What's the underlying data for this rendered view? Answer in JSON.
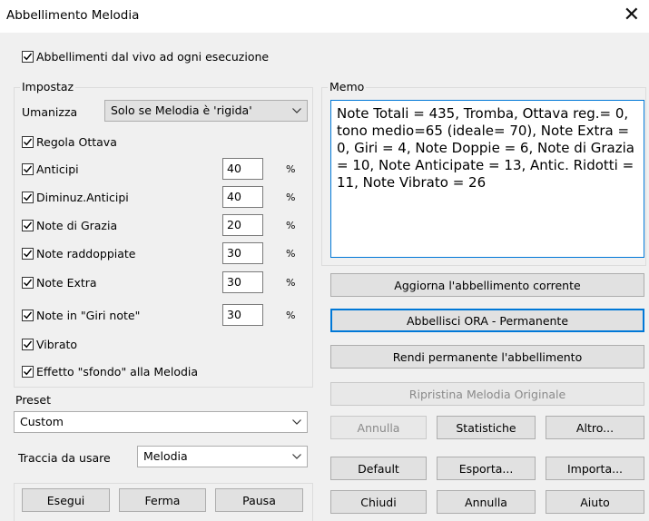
{
  "window": {
    "title": "Abbellimento Melodia"
  },
  "live_checkbox": {
    "label": "Abbellimenti dal vivo ad ogni esecuzione",
    "checked": true
  },
  "settings": {
    "group_label": "Impostaz",
    "humanize": {
      "label": "Umanizza",
      "value": "Solo se Melodia è 'rigida'"
    },
    "adjust_octave": {
      "label": "Regola Ottava",
      "checked": true
    },
    "items": [
      {
        "label": "Anticipi",
        "checked": true,
        "value": "40",
        "unit": "%"
      },
      {
        "label": "Diminuz.Anticipi",
        "checked": true,
        "value": "40",
        "unit": "%"
      },
      {
        "label": "Note di Grazia",
        "checked": true,
        "value": "20",
        "unit": "%"
      },
      {
        "label": "Note raddoppiate",
        "checked": true,
        "value": "30",
        "unit": "%"
      },
      {
        "label": "Note Extra",
        "checked": true,
        "value": "30",
        "unit": "%"
      },
      {
        "label": "Note in \"Giri note\"",
        "checked": true,
        "value": "30",
        "unit": "%"
      }
    ],
    "vibrato": {
      "label": "Vibrato",
      "checked": true
    },
    "background_effect": {
      "label": "Effetto \"sfondo\" alla Melodia",
      "checked": true
    }
  },
  "preset": {
    "label": "Preset",
    "value": "Custom"
  },
  "track": {
    "label": "Traccia da usare",
    "value": "Melodia"
  },
  "playback": {
    "play": "Esegui",
    "stop": "Ferma",
    "pause": "Pausa"
  },
  "memo": {
    "label": "Memo",
    "text": "Note Totali = 435,  Tromba, Ottava reg.= 0, tono medio=65 (ideale= 70), Note Extra = 0,  Giri = 4,  Note Doppie = 6,  Note di Grazia = 10,  Note Anticipate = 13,  Antic. Ridotti = 11,  Note Vibrato = 26"
  },
  "actions": {
    "update": "Aggiorna l'abbellimento corrente",
    "embellish_now": "Abbellisci ORA - Permanente",
    "make_permanent": "Rendi permanente l'abbellimento",
    "restore": "Ripristina Melodia Originale",
    "undo": "Annulla",
    "stats": "Statistiche",
    "more": "Altro...",
    "default": "Default",
    "export": "Esporta...",
    "import": "Importa...",
    "close": "Chiudi",
    "cancel": "Annulla",
    "help": "Aiuto"
  },
  "colors": {
    "focus_border": "#0078d7",
    "disabled_text": "#8a8a8a"
  }
}
